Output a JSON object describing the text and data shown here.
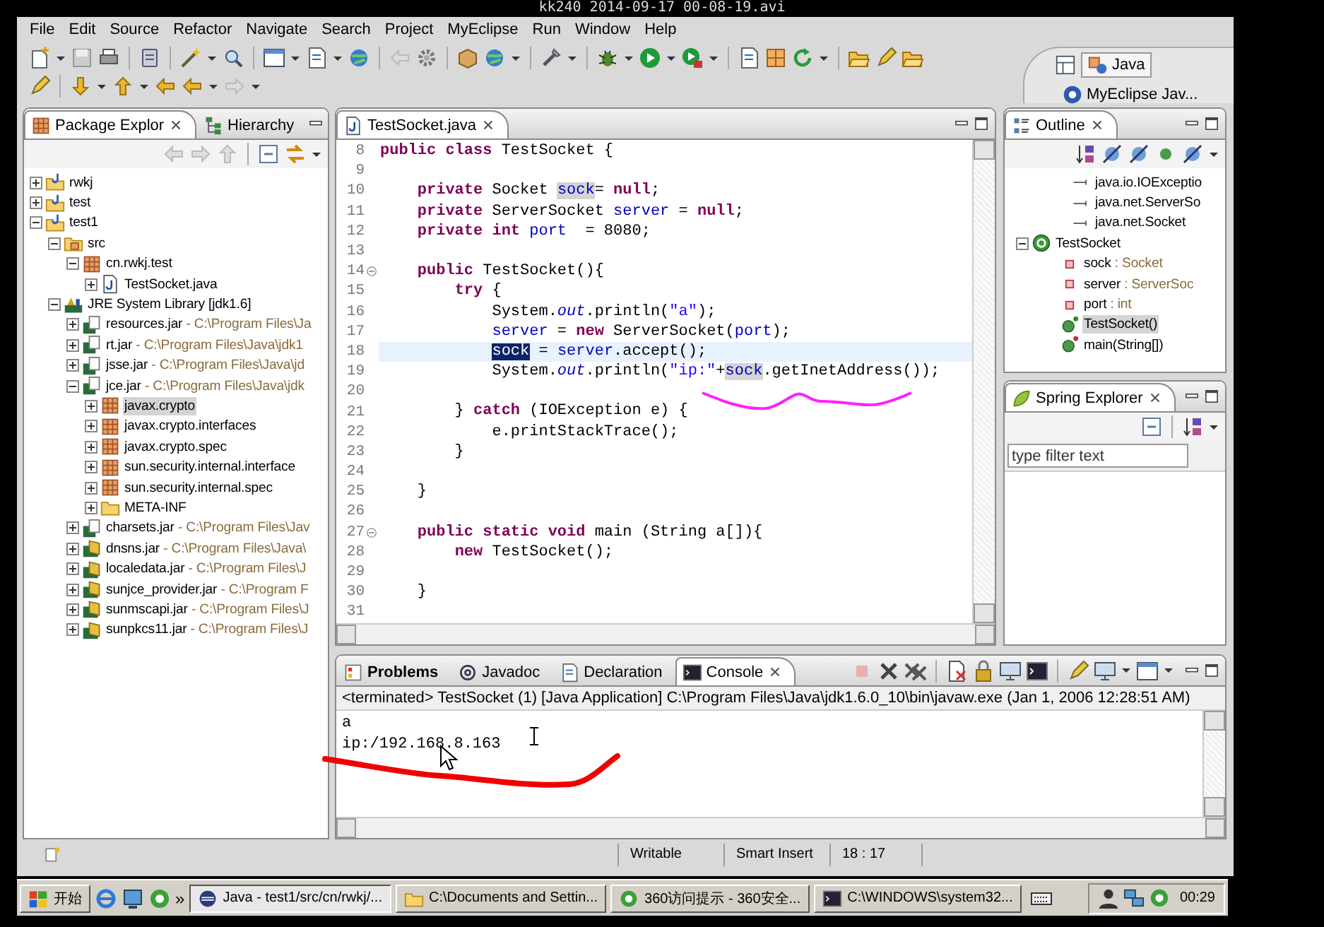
{
  "player": {
    "title": "kk240 2014-09-17 00-08-19.avi"
  },
  "menu": [
    "File",
    "Edit",
    "Source",
    "Refactor",
    "Navigate",
    "Search",
    "Project",
    "MyEclipse",
    "Run",
    "Window",
    "Help"
  ],
  "perspectives": [
    {
      "label": "Java",
      "selected": true
    },
    {
      "label": "MyEclipse Jav...",
      "selected": false
    }
  ],
  "package_explorer": {
    "tabs": [
      {
        "label": "Package Explor",
        "selected": true
      },
      {
        "label": "Hierarchy",
        "selected": false
      }
    ],
    "tree": [
      {
        "label": "rwkj",
        "kind": "project",
        "expanded": false,
        "selected": false
      },
      {
        "label": "test",
        "kind": "project",
        "expanded": false,
        "selected": false
      },
      {
        "label": "test1",
        "kind": "project",
        "expanded": true,
        "selected": false,
        "children": [
          {
            "label": "src",
            "kind": "source-folder",
            "expanded": true,
            "selected": false,
            "children": [
              {
                "label": "cn.rwkj.test",
                "kind": "package",
                "expanded": true,
                "selected": false,
                "children": [
                  {
                    "label": "TestSocket.java",
                    "kind": "java-file",
                    "expanded": false,
                    "selected": false
                  }
                ]
              }
            ]
          },
          {
            "label": "JRE System Library [jdk1.6]",
            "kind": "library",
            "expanded": true,
            "selected": false,
            "children": [
              {
                "label": "resources.jar",
                "detail": "- C:\\Program Files\\Ja",
                "kind": "jar",
                "expanded": false,
                "selected": false
              },
              {
                "label": "rt.jar",
                "detail": "- C:\\Program Files\\Java\\jdk1",
                "kind": "jar",
                "expanded": false,
                "selected": false
              },
              {
                "label": "jsse.jar",
                "detail": "- C:\\Program Files\\Java\\jd",
                "kind": "jar",
                "expanded": false,
                "selected": false
              },
              {
                "label": "jce.jar",
                "detail": "- C:\\Program Files\\Java\\jdk",
                "kind": "jar",
                "expanded": true,
                "selected": false,
                "children": [
                  {
                    "label": "javax.crypto",
                    "kind": "package",
                    "expanded": false,
                    "selected": true
                  },
                  {
                    "label": "javax.crypto.interfaces",
                    "kind": "package",
                    "expanded": false,
                    "selected": false
                  },
                  {
                    "label": "javax.crypto.spec",
                    "kind": "package",
                    "expanded": false,
                    "selected": false
                  },
                  {
                    "label": "sun.security.internal.interface",
                    "kind": "package",
                    "expanded": false,
                    "selected": false
                  },
                  {
                    "label": "sun.security.internal.spec",
                    "kind": "package",
                    "expanded": false,
                    "selected": false
                  },
                  {
                    "label": "META-INF",
                    "kind": "folder",
                    "expanded": false,
                    "selected": false
                  }
                ]
              },
              {
                "label": "charsets.jar",
                "detail": "- C:\\Program Files\\Jav",
                "kind": "jar",
                "expanded": false,
                "selected": false
              },
              {
                "label": "dnsns.jar",
                "detail": "- C:\\Program Files\\Java\\",
                "kind": "ext-jar",
                "expanded": false,
                "selected": false
              },
              {
                "label": "localedata.jar",
                "detail": "- C:\\Program Files\\J",
                "kind": "ext-jar",
                "expanded": false,
                "selected": false
              },
              {
                "label": "sunjce_provider.jar",
                "detail": "- C:\\Program F",
                "kind": "ext-jar",
                "expanded": false,
                "selected": false
              },
              {
                "label": "sunmscapi.jar",
                "detail": "- C:\\Program Files\\J",
                "kind": "ext-jar",
                "expanded": false,
                "selected": false
              },
              {
                "label": "sunpkcs11.jar",
                "detail": "- C:\\Program Files\\J",
                "kind": "ext-jar",
                "expanded": false,
                "selected": false
              }
            ]
          }
        ]
      }
    ]
  },
  "editor": {
    "tabs": [
      {
        "label": "TestSocket.java",
        "selected": true
      }
    ],
    "lines": [
      {
        "number": "8",
        "current": false,
        "foldable": false,
        "segments": [
          {
            "text": "public class",
            "kind": "keyword"
          },
          {
            "text": " TestSocket {",
            "kind": "plain"
          }
        ]
      },
      {
        "number": "9",
        "current": false,
        "foldable": false
      },
      {
        "number": "10",
        "current": false,
        "foldable": false,
        "segments": [
          {
            "text": "    private",
            "kind": "keyword"
          },
          {
            "text": " Socket ",
            "kind": "plain"
          },
          {
            "text": "sock",
            "kind": "occurrence"
          },
          {
            "text": "= ",
            "kind": "plain"
          },
          {
            "text": "null",
            "kind": "keyword"
          },
          {
            "text": ";",
            "kind": "plain"
          }
        ]
      },
      {
        "number": "11",
        "current": false,
        "foldable": false,
        "segments": [
          {
            "text": "    private",
            "kind": "keyword"
          },
          {
            "text": " ServerSocket ",
            "kind": "plain"
          },
          {
            "text": "server",
            "kind": "field"
          },
          {
            "text": " = ",
            "kind": "plain"
          },
          {
            "text": "null",
            "kind": "keyword"
          },
          {
            "text": ";",
            "kind": "plain"
          }
        ]
      },
      {
        "number": "12",
        "current": false,
        "foldable": false,
        "segments": [
          {
            "text": "    private int ",
            "kind": "keyword"
          },
          {
            "text": "port",
            "kind": "field"
          },
          {
            "text": "  = 8080;",
            "kind": "plain"
          }
        ]
      },
      {
        "number": "13",
        "current": false,
        "foldable": false
      },
      {
        "number": "14",
        "current": false,
        "foldable": true,
        "segments": [
          {
            "text": "    public",
            "kind": "keyword"
          },
          {
            "text": " TestSocket(){",
            "kind": "plain"
          }
        ]
      },
      {
        "number": "15",
        "current": false,
        "foldable": false,
        "segments": [
          {
            "text": "        try",
            "kind": "keyword"
          },
          {
            "text": " {",
            "kind": "plain"
          }
        ]
      },
      {
        "number": "16",
        "current": false,
        "foldable": false,
        "segments": [
          {
            "text": "            System.",
            "kind": "plain"
          },
          {
            "text": "out",
            "kind": "static-field"
          },
          {
            "text": ".println(",
            "kind": "plain"
          },
          {
            "text": "\"a\"",
            "kind": "string"
          },
          {
            "text": ");",
            "kind": "plain"
          }
        ]
      },
      {
        "number": "17",
        "current": false,
        "foldable": false,
        "segments": [
          {
            "text": "            server",
            "kind": "field"
          },
          {
            "text": " = ",
            "kind": "plain"
          },
          {
            "text": "new",
            "kind": "keyword"
          },
          {
            "text": " ServerSocket(",
            "kind": "plain"
          },
          {
            "text": "port",
            "kind": "field"
          },
          {
            "text": ");",
            "kind": "plain"
          }
        ]
      },
      {
        "number": "18",
        "current": true,
        "foldable": false,
        "segments": [
          {
            "text": "            sock",
            "kind": "selection"
          },
          {
            "text": " = ",
            "kind": "plain"
          },
          {
            "text": "server",
            "kind": "field"
          },
          {
            "text": ".accept();",
            "kind": "plain"
          }
        ]
      },
      {
        "number": "19",
        "current": false,
        "foldable": false,
        "segments": [
          {
            "text": "            System.",
            "kind": "plain"
          },
          {
            "text": "out",
            "kind": "static-field"
          },
          {
            "text": ".println(",
            "kind": "plain"
          },
          {
            "text": "\"ip:\"",
            "kind": "string"
          },
          {
            "text": "+",
            "kind": "plain"
          },
          {
            "text": "sock",
            "kind": "occurrence"
          },
          {
            "text": ".getInetAddress());",
            "kind": "plain"
          }
        ]
      },
      {
        "number": "20",
        "current": false,
        "foldable": false
      },
      {
        "number": "21",
        "current": false,
        "foldable": false,
        "segments": [
          {
            "text": "        } ",
            "kind": "plain"
          },
          {
            "text": "catch",
            "kind": "keyword"
          },
          {
            "text": " (IOException e) {",
            "kind": "plain"
          }
        ]
      },
      {
        "number": "22",
        "current": false,
        "foldable": false,
        "segments": [
          {
            "text": "            e.printStackTrace();",
            "kind": "plain"
          }
        ]
      },
      {
        "number": "23",
        "current": false,
        "foldable": false,
        "segments": [
          {
            "text": "        }",
            "kind": "plain"
          }
        ]
      },
      {
        "number": "24",
        "current": false,
        "foldable": false
      },
      {
        "number": "25",
        "current": false,
        "foldable": false,
        "segments": [
          {
            "text": "    }",
            "kind": "plain"
          }
        ]
      },
      {
        "number": "26",
        "current": false,
        "foldable": false
      },
      {
        "number": "27",
        "current": false,
        "foldable": true,
        "segments": [
          {
            "text": "    public static void",
            "kind": "keyword"
          },
          {
            "text": " main (String a[]){",
            "kind": "plain"
          }
        ]
      },
      {
        "number": "28",
        "current": false,
        "foldable": false,
        "segments": [
          {
            "text": "        new",
            "kind": "keyword"
          },
          {
            "text": " TestSocket();",
            "kind": "plain"
          }
        ]
      },
      {
        "number": "29",
        "current": false,
        "foldable": false
      },
      {
        "number": "30",
        "current": false,
        "foldable": false,
        "segments": [
          {
            "text": "    }",
            "kind": "plain"
          }
        ]
      },
      {
        "number": "31",
        "current": false,
        "foldable": false
      }
    ]
  },
  "outline": {
    "tabs": [
      {
        "label": "Outline",
        "selected": true
      }
    ],
    "tree": [
      {
        "label": "java.io.IOExceptio",
        "kind": "import",
        "selected": false
      },
      {
        "label": "java.net.ServerSo",
        "kind": "import",
        "selected": false
      },
      {
        "label": "java.net.Socket",
        "kind": "import",
        "selected": false
      },
      {
        "label": "TestSocket",
        "kind": "class",
        "expanded": true,
        "selected": false,
        "children": [
          {
            "label": "sock",
            "detail": ": Socket",
            "kind": "field",
            "selected": false
          },
          {
            "label": "server",
            "detail": ": ServerSoc",
            "kind": "field",
            "selected": false
          },
          {
            "label": "port",
            "detail": ": int",
            "kind": "field",
            "selected": false
          },
          {
            "label": "TestSocket()",
            "kind": "constructor",
            "selected": true
          },
          {
            "label": "main(String[])",
            "kind": "static-method",
            "selected": false
          }
        ]
      }
    ]
  },
  "spring_explorer": {
    "tabs": [
      {
        "label": "Spring Explorer",
        "selected": true
      }
    ],
    "filter": {
      "placeholder": "type filter text"
    }
  },
  "bottom_panel": {
    "tabs": [
      {
        "label": "Problems",
        "selected": false,
        "emphasized": true
      },
      {
        "label": "Javadoc",
        "selected": false,
        "emphasized": false
      },
      {
        "label": "Declaration",
        "selected": false,
        "emphasized": false
      },
      {
        "label": "Console",
        "selected": true,
        "emphasized": false
      }
    ],
    "console": {
      "header": "<terminated> TestSocket (1) [Java Application] C:\\Program Files\\Java\\jdk1.6.0_10\\bin\\javaw.exe (Jan 1, 2006 12:28:51 AM)",
      "output": [
        "a",
        "ip:/192.168.8.163"
      ]
    }
  },
  "status_bar": {
    "items": [
      "Writable",
      "Smart Insert",
      "18 : 17"
    ]
  },
  "taskbar": {
    "start": "开始",
    "overflow": "»",
    "tasks": [
      {
        "label": "Java - test1/src/cn/rwkj/...",
        "kind": "eclipse",
        "selected": true
      },
      {
        "label": "C:\\Documents and Settin...",
        "kind": "folder",
        "selected": false
      },
      {
        "label": "360访问提示 - 360安全...",
        "kind": "shield",
        "selected": false
      },
      {
        "label": "C:\\WINDOWS\\system32...",
        "kind": "console",
        "selected": false
      }
    ],
    "clock": "00:29"
  }
}
